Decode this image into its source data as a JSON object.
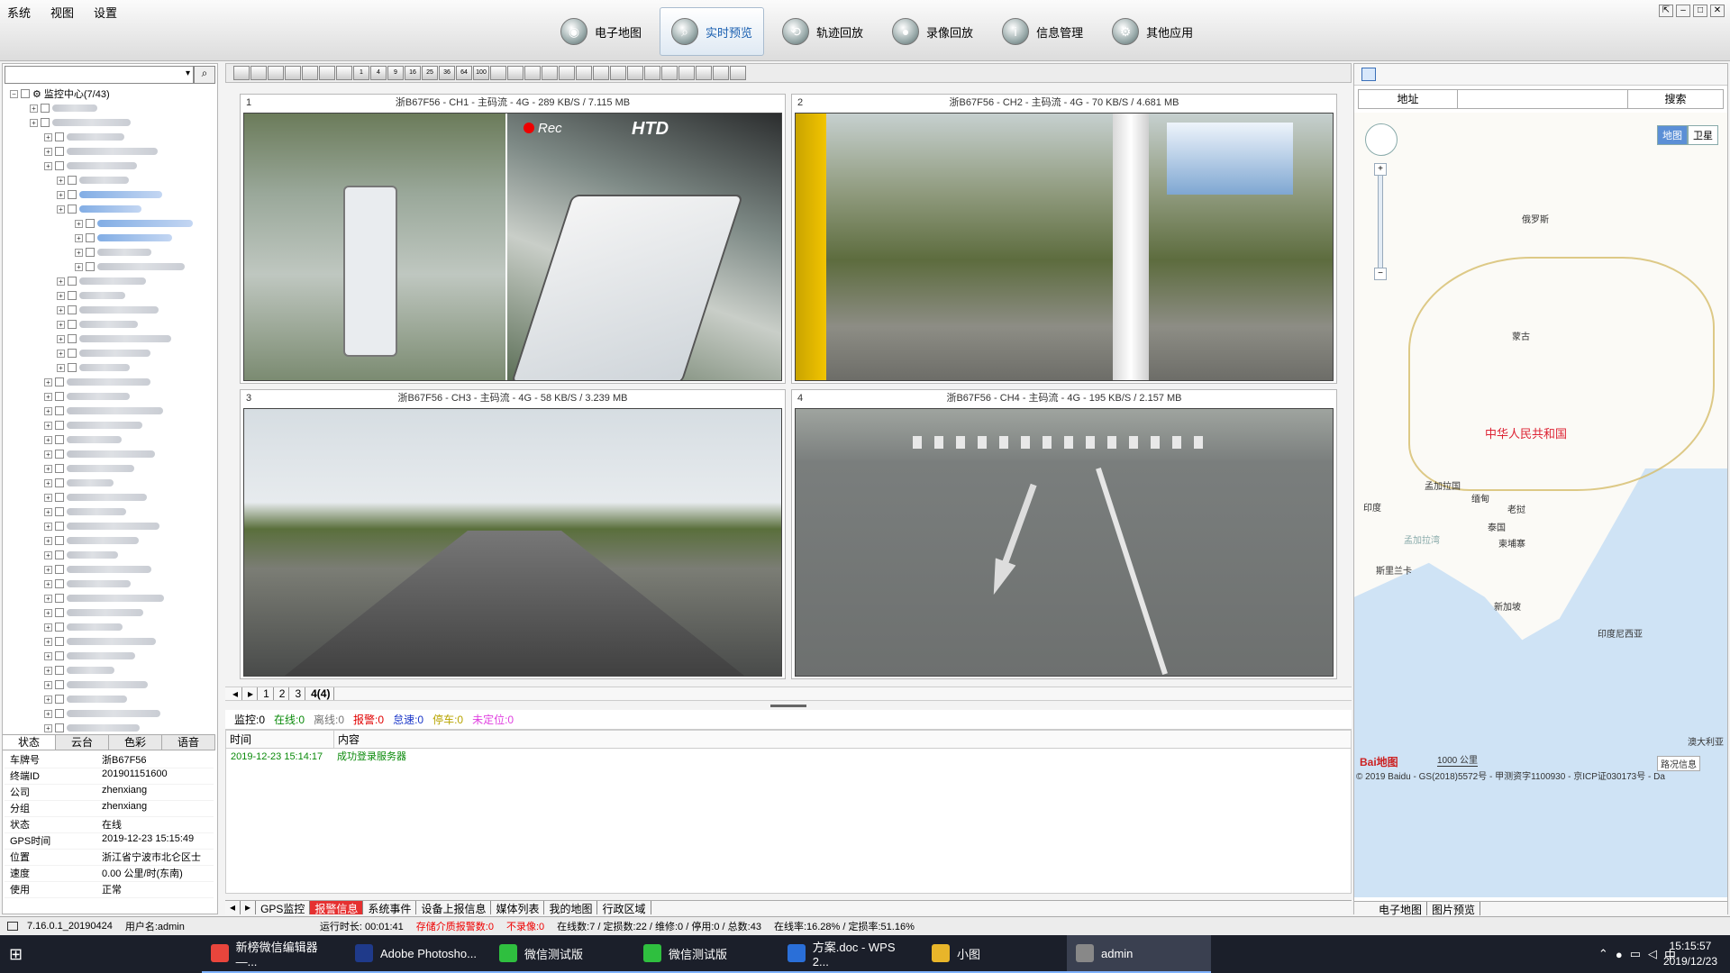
{
  "menu": [
    "系统",
    "视图",
    "设置"
  ],
  "window_controls": [
    "⇱",
    "‒",
    "□",
    "✕"
  ],
  "modules": [
    {
      "label": "电子地图",
      "icon": "map-icon",
      "active": false
    },
    {
      "label": "实时预览",
      "icon": "search-icon",
      "active": true
    },
    {
      "label": "轨迹回放",
      "icon": "track-icon",
      "active": false
    },
    {
      "label": "录像回放",
      "icon": "record-icon",
      "active": false
    },
    {
      "label": "信息管理",
      "icon": "info-icon",
      "active": false
    },
    {
      "label": "其他应用",
      "icon": "apps-icon",
      "active": false
    }
  ],
  "tree": {
    "root": "监控中心(7/43)"
  },
  "info_tabs": [
    "状态",
    "云台",
    "色彩",
    "语音"
  ],
  "info": [
    {
      "k": "车牌号",
      "v": "浙B67F56"
    },
    {
      "k": "终端ID",
      "v": "201901151600"
    },
    {
      "k": "公司",
      "v": "zhenxiang"
    },
    {
      "k": "分组",
      "v": "zhenxiang"
    },
    {
      "k": "状态",
      "v": "在线"
    },
    {
      "k": "GPS时间",
      "v": "2019-12-23 15:15:49"
    },
    {
      "k": "位置",
      "v": "浙江省宁波市北仑区士"
    },
    {
      "k": "速度",
      "v": "0.00 公里/时(东南)"
    },
    {
      "k": "使用",
      "v": "正常"
    }
  ],
  "video_toolbar": [
    "1",
    "4",
    "9",
    "16",
    "25",
    "36",
    "64",
    "100"
  ],
  "videos": [
    {
      "n": "1",
      "title": "浙B67F56 - CH1 - 主码流 - 4G - 289 KB/S / 7.115 MB",
      "rec": "Rec",
      "logo": "HTD"
    },
    {
      "n": "2",
      "title": "浙B67F56 - CH2 - 主码流 - 4G - 70 KB/S / 4.681 MB"
    },
    {
      "n": "3",
      "title": "浙B67F56 - CH3 - 主码流 - 4G - 58 KB/S / 3.239 MB"
    },
    {
      "n": "4",
      "title": "浙B67F56 - CH4 - 主码流 - 4G - 195 KB/S / 2.157 MB"
    }
  ],
  "page_tabs": [
    "1",
    "2",
    "3",
    "4(4)"
  ],
  "counts": [
    {
      "label": "监控:0",
      "color": "#000000"
    },
    {
      "label": "在线:0",
      "color": "#0a8a0a"
    },
    {
      "label": "离线:0",
      "color": "#777777"
    },
    {
      "label": "报警:0",
      "color": "#e00000"
    },
    {
      "label": "怠速:0",
      "color": "#1a36c8"
    },
    {
      "label": "停车:0",
      "color": "#b8a400"
    },
    {
      "label": "未定位:0",
      "color": "#e040e0"
    }
  ],
  "log": {
    "col_time": "时间",
    "col_content": "内容",
    "rows": [
      {
        "time": "2019-12-23 15:14:17",
        "content": "成功登录服务器"
      }
    ]
  },
  "bottom_tabs": [
    {
      "label": "GPS监控",
      "on": false
    },
    {
      "label": "报警信息",
      "on": true
    },
    {
      "label": "系统事件",
      "on": false
    },
    {
      "label": "设备上报信息",
      "on": false
    },
    {
      "label": "媒体列表",
      "on": false
    },
    {
      "label": "我的地图",
      "on": false
    },
    {
      "label": "行政区域",
      "on": false
    }
  ],
  "map": {
    "addr_label": "地址",
    "search_label": "搜索",
    "types": [
      "地图",
      "卫星"
    ],
    "labels": {
      "russia": "俄罗斯",
      "mongolia": "蒙古",
      "china": "中华人民共和国",
      "bangladesh": "孟加拉国",
      "myanmar": "缅甸",
      "india": "印度",
      "laos": "老挝",
      "thailand": "泰国",
      "cambodia": "柬埔寨",
      "bay": "孟加拉湾",
      "srilanka": "斯里兰卡",
      "singapore": "新加坡",
      "indonesia": "印度尼西亚",
      "australia": "澳大利亚",
      "traffic": "路况信息",
      "baidu": "Bai地图"
    },
    "scale": "1000 公里",
    "copyright": "© 2019 Baidu - GS(2018)5572号 - 甲测资字1100930 - 京ICP证030173号 - Da",
    "tabs": [
      "电子地图",
      "图片预览"
    ]
  },
  "app_status": {
    "version": "7.16.0.1_20190424",
    "user": "用户名:admin",
    "runtime": "运行时长: 00:01:41",
    "storage_alarm": "存储介质报警数:0",
    "no_record": "不录像:0",
    "online_stats": "在线数:7 / 定损数:22 / 维修:0 / 停用:0 / 总数:43",
    "rates": "在线率:16.28% / 定损率:51.16%"
  },
  "taskbar": {
    "apps": [
      {
        "label": "新榜微信编辑器—...",
        "color": "#e8453c"
      },
      {
        "label": "Adobe Photosho...",
        "color": "#1f3a8a"
      },
      {
        "label": "微信测试版",
        "color": "#2fbf3f"
      },
      {
        "label": "微信测试版",
        "color": "#2fbf3f"
      },
      {
        "label": "方案.doc - WPS 2...",
        "color": "#2a6fd8"
      },
      {
        "label": "小图",
        "color": "#e8b52a"
      },
      {
        "label": "admin",
        "color": "#888888"
      }
    ],
    "time": "15:15:57",
    "date": "2019/12/23"
  }
}
